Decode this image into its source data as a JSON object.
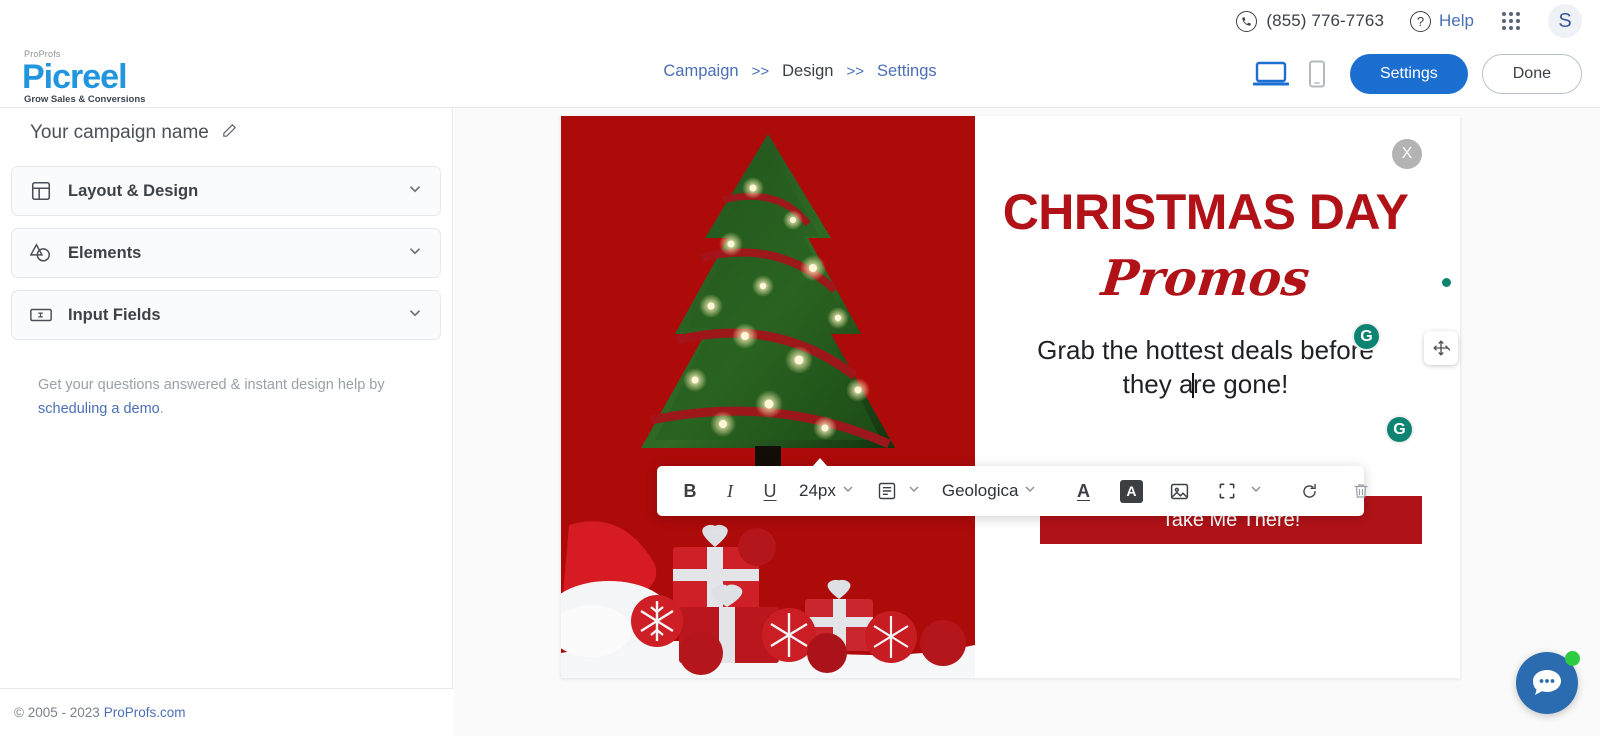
{
  "utilbar": {
    "phone": "(855) 776-7763",
    "help_label": "Help",
    "apps_icon": "apps-grid-icon",
    "avatar_initial": "S"
  },
  "logo": {
    "brand_top": "ProProfs",
    "brand_main": "Picreel",
    "tagline": "Grow Sales & Conversions",
    "color": "#2196de"
  },
  "header": {
    "breadcrumb": [
      {
        "label": "Campaign",
        "active": false
      },
      {
        "label": "Design",
        "active": true
      },
      {
        "label": "Settings",
        "active": false
      }
    ],
    "separator": ">>",
    "device_desktop": "desktop-view-icon",
    "device_mobile": "mobile-view-icon",
    "settings_label": "Settings",
    "done_label": "Done",
    "primary_color": "#1b6fd0"
  },
  "sidebar": {
    "campaign_name": "Your campaign name",
    "edit_icon": "pencil-edit-icon",
    "accordions": [
      {
        "label": "Layout & Design",
        "icon": "layout-grid-icon"
      },
      {
        "label": "Elements",
        "icon": "shapes-icon"
      },
      {
        "label": "Input Fields",
        "icon": "input-field-icon"
      }
    ],
    "help_text": "Get your questions answered & instant design help by",
    "help_link": "scheduling a demo",
    "help_suffix": "."
  },
  "footer": {
    "copyright": "© 2005 - 2023",
    "link": "ProProfs.com"
  },
  "popup": {
    "close_label": "X",
    "headline": "CHRISTMAS DAY",
    "script_word": "Promos",
    "sub_line1": "Grab the hottest deals before",
    "sub_before_caret": "they a",
    "sub_after_caret": "re gone!",
    "cta_label": "Take Me There!",
    "brand_red": "#b01217",
    "panel_red": "#ad0a0a"
  },
  "toolbar": {
    "bold": "B",
    "italic": "I",
    "underline": "U",
    "font_size": "24px",
    "align_icon": "text-align-icon",
    "font_family": "Geologica",
    "text_color_icon": "text-color-icon",
    "highlight_icon": "highlight-color-icon",
    "image_icon": "insert-image-icon",
    "crop_icon": "crop-frame-icon",
    "reset_icon": "reset-icon",
    "delete_icon": "trash-icon",
    "chevron": "chevron-down-icon"
  },
  "overlays": {
    "grammarly_letter": "G",
    "move_handle_icon": "move-arrows-icon",
    "chat_icon": "chat-bubble-icon"
  }
}
